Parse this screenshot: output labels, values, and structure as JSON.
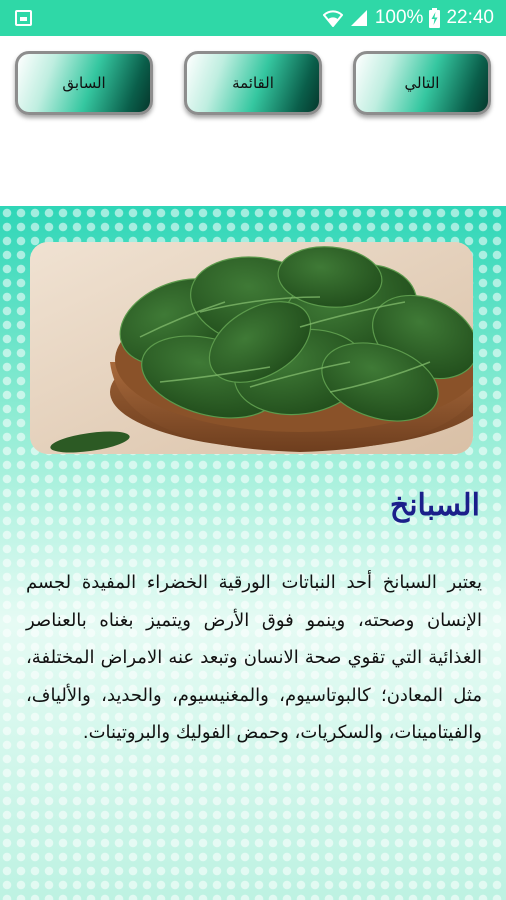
{
  "status_bar": {
    "battery_percent": "100%",
    "time": "22:40",
    "icons": [
      "gallery-icon",
      "wifi-icon",
      "signal-icon",
      "battery-charging-icon"
    ]
  },
  "nav": {
    "prev_label": "السابق",
    "list_label": "القائمة",
    "next_label": "التالي"
  },
  "article": {
    "image": "spinach-bowl",
    "title": "السبانخ",
    "body": "يعتبر السبانخ أحد النباتات الورقية الخضراء المفيدة لجسم الإنسان وصحته، وينمو فوق الأرض ويتميز بغناه بالعناصر الغذائية التي تقوي صحة الانسان وتبعد عنه الامراض المختلفة، مثل المعادن؛ كالبوتاسيوم، والمغنيسيوم، والحديد، والألياف، والفيتامينات، والسكريات، وحمض الفوليك والبروتينات."
  },
  "colors": {
    "status_bar": "#2fd8a7",
    "title": "#1b1f8a",
    "button_dark": "#06372c"
  }
}
